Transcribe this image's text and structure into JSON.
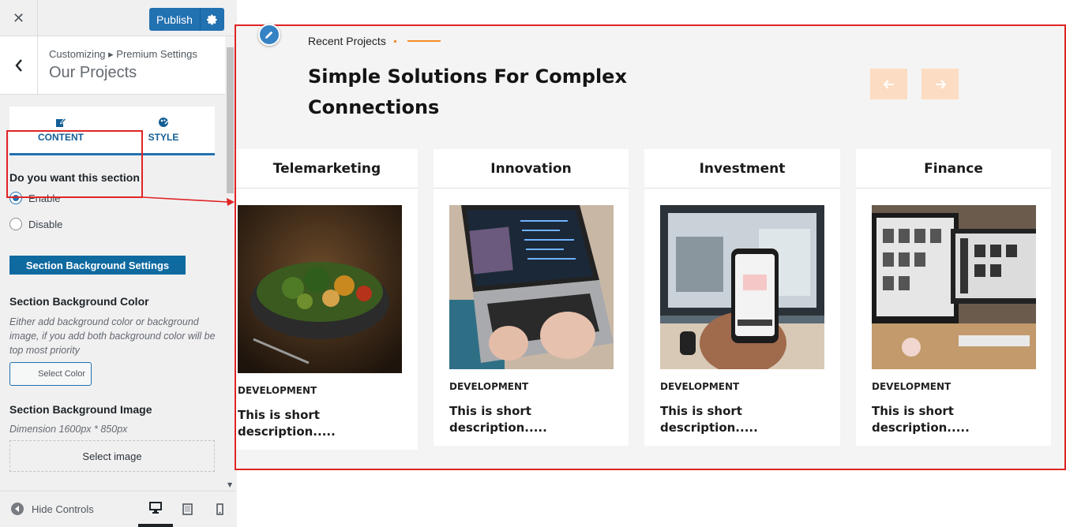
{
  "topbar": {
    "close_icon": "close-icon",
    "publish_label": "Publish",
    "publish_settings_icon": "gear-icon"
  },
  "section_header": {
    "breadcrumb": "Customizing ▸ Premium Settings",
    "title": "Our Projects"
  },
  "tabs": [
    {
      "label": "CONTENT",
      "icon": "edit-icon"
    },
    {
      "label": "STYLE",
      "icon": "palette-icon"
    }
  ],
  "enable_section": {
    "question": "Do you want this section",
    "options": [
      {
        "label": "Enable",
        "selected": true
      },
      {
        "label": "Disable",
        "selected": false
      }
    ]
  },
  "background": {
    "settings_button": "Section Background Settings",
    "color_title": "Section Background Color",
    "color_desc": "Either add background color or background image, if you add both background color will be top most priority",
    "color_button": "Select Color",
    "image_title": "Section Background Image",
    "image_desc": "Dimension 1600px * 850px",
    "image_button": "Select image"
  },
  "footer": {
    "hide_controls": "Hide Controls",
    "devices": [
      "desktop-icon",
      "tablet-icon",
      "mobile-icon"
    ],
    "active_device": "desktop"
  },
  "preview": {
    "subtitle": "Recent Projects",
    "headline": "Simple Solutions For Complex Connections",
    "accent_color": "#f28c28",
    "nav_prev_icon": "arrow-left-icon",
    "nav_next_icon": "arrow-right-icon",
    "cards": [
      {
        "title": "Telemarketing",
        "category": "DEVELOPMENT",
        "description": "This is short description.....",
        "image": "food-bowl-photo"
      },
      {
        "title": "Innovation",
        "category": "DEVELOPMENT",
        "description": "This is short description.....",
        "image": "laptop-video-call-photo"
      },
      {
        "title": "Investment",
        "category": "DEVELOPMENT",
        "description": "This is short description.....",
        "image": "phone-in-hand-photo"
      },
      {
        "title": "Finance",
        "category": "DEVELOPMENT",
        "description": "This is short description.....",
        "image": "desk-monitors-photo"
      }
    ]
  }
}
